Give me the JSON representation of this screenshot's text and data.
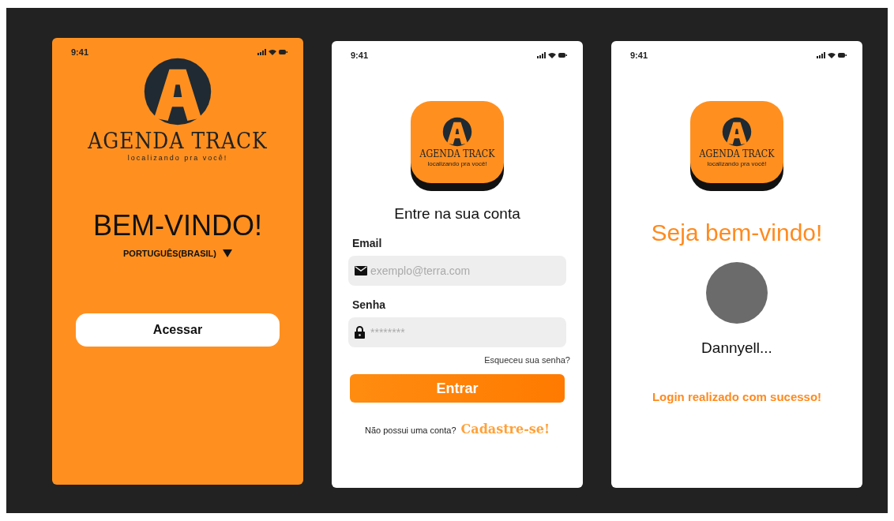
{
  "screens": [
    {
      "kind": "welcome",
      "time": "9:41",
      "brand": "AGENDA TRACK",
      "tagline": "localizando pra você!",
      "heading": "BEM-VINDO!",
      "language": "PORTUGUÊS(BRASIL)",
      "button": "Acessar"
    },
    {
      "kind": "login",
      "time": "9:41",
      "brand": "AGENDA TRACK",
      "tagline": "localizando pra você!",
      "heading": "Entre na sua conta",
      "fields": [
        {
          "label": "Email",
          "placeholder": "exemplo@terra.com",
          "kind": "email"
        },
        {
          "label": "Senha",
          "placeholder": "********",
          "kind": "password"
        }
      ],
      "forgot": "Esqueceu sua senha?",
      "button": "Entrar",
      "signup_text": "Não possui uma conta?",
      "signup_link": "Cadastre-se!"
    },
    {
      "kind": "success",
      "time": "9:41",
      "brand": "AGENDA TRACK",
      "tagline": "localizando pra você!",
      "heading": "Seja bem-vindo!",
      "user_name": "Dannyell...",
      "message": "Login realizado com sucesso!"
    }
  ]
}
